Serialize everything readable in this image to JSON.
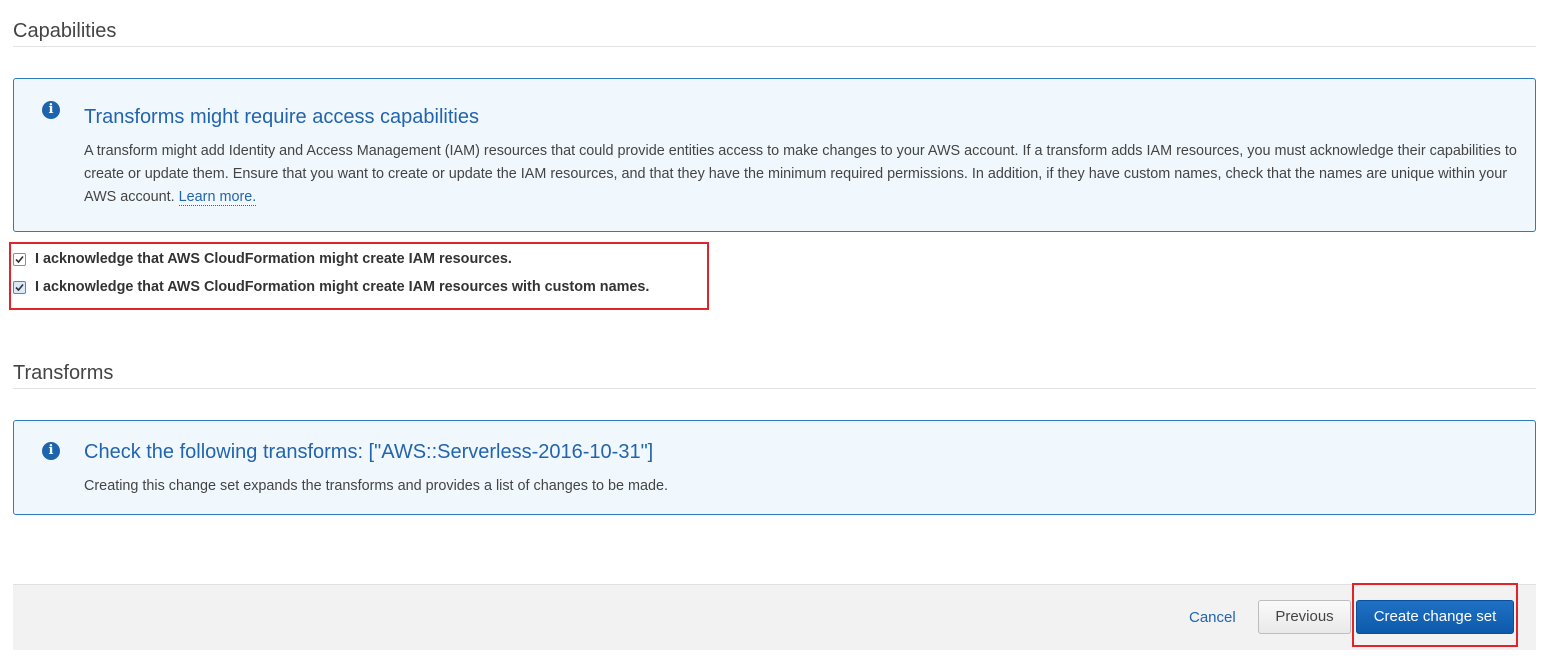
{
  "capabilities": {
    "section_title": "Capabilities",
    "info": {
      "icon": "info-icon",
      "title": "Transforms might require access capabilities",
      "body": "A transform might add Identity and Access Management (IAM) resources that could provide entities access to make changes to your AWS account. If a transform adds IAM resources, you must acknowledge their capabilities to create or update them. Ensure that you want to create or update the IAM resources, and that they have the minimum required permissions. In addition, if they have custom names, check that the names are unique within your AWS account.",
      "link_text": "Learn more."
    },
    "acknowledgements": [
      {
        "label": "I acknowledge that AWS CloudFormation might create IAM resources.",
        "checked": true
      },
      {
        "label": "I acknowledge that AWS CloudFormation might create IAM resources with custom names.",
        "checked": true
      }
    ]
  },
  "transforms": {
    "section_title": "Transforms",
    "info": {
      "icon": "info-icon",
      "title": "Check the following transforms: [\"AWS::Serverless-2016-10-31\"]",
      "body": "Creating this change set expands the transforms and provides a list of changes to be made."
    }
  },
  "footer": {
    "cancel_label": "Cancel",
    "previous_label": "Previous",
    "create_label": "Create change set"
  },
  "colors": {
    "accent": "#2264ae",
    "primary_button": "#1166bb",
    "highlight": "#e2232a",
    "info_bg": "#f1f8fd"
  }
}
